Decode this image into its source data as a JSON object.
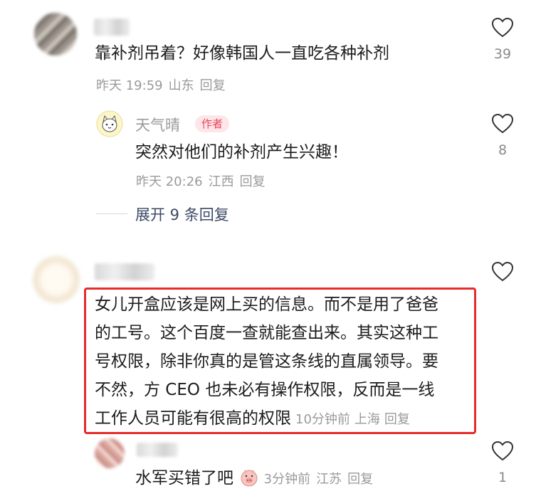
{
  "comments": [
    {
      "text": "靠补剂吊着？好像韩国人一直吃各种补剂",
      "time": "昨天 19:59",
      "location": "山东",
      "reply": "回复",
      "likes": "39",
      "replies": [
        {
          "name": "天气晴",
          "badge": "作者",
          "text": "突然对他们的补剂产生兴趣！",
          "time": "昨天 20:26",
          "location": "江西",
          "reply": "回复",
          "likes": "8"
        }
      ],
      "expand": "展开 9 条回复"
    },
    {
      "lines": [
        "女儿开盒应该是网上买的信息。而不是用了爸爸",
        "的工号。这个百度一查就能查出来。其实这种工",
        "号权限，除非你真的是管这条线的直属领导。要",
        "不然，方 CEO 也未必有操作权限，反而是一线",
        "工作人员可能有很高的权限"
      ],
      "time": "10分钟前",
      "location": "上海",
      "reply": "回复",
      "likes": "",
      "replies": [
        {
          "text": "水军买错了吧",
          "emoji": "pig-face-emoji",
          "time": "3分钟前",
          "location": "江苏",
          "reply": "回复",
          "likes": "1"
        }
      ]
    }
  ],
  "colors": {
    "highlight": "#e62c2c",
    "author_badge": "#e8465a",
    "expand_link": "#3c4a66"
  }
}
